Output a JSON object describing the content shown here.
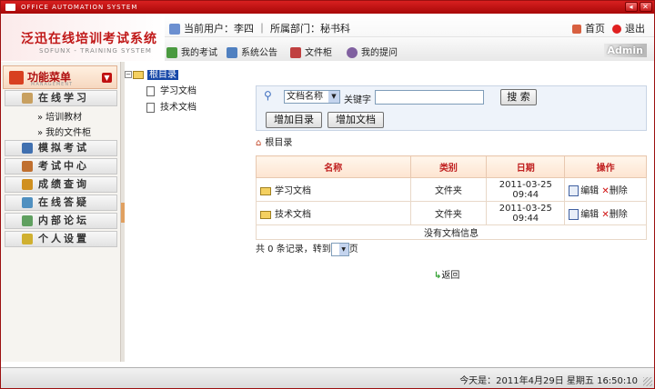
{
  "window": {
    "title": "OFFICE AUTOMATION SYSTEM"
  },
  "header": {
    "logo_title": "泛迅在线培训考试系统",
    "logo_sub": "SOFUNX - TRAINING SYSTEM",
    "user_info": "当前用户：李四 ｜ 所属部门：秘书科",
    "home": "首页",
    "logout": "退出",
    "nav": [
      "我的考试",
      "系统公告",
      "文件柜",
      "我的提问"
    ],
    "admin": "Admin"
  },
  "sidebar": {
    "title": "功能菜单",
    "subtitle": "MANAGEMENT",
    "items": [
      "在线学习",
      "模拟考试",
      "考试中心",
      "成绩查询",
      "在线答疑",
      "内部论坛",
      "个人设置"
    ],
    "subitems": [
      "培训教材",
      "我的文件柜"
    ]
  },
  "tree": {
    "root": "根目录",
    "children": [
      "学习文档",
      "技术文档"
    ]
  },
  "search": {
    "field": "文档名称",
    "keyword_label": "关键字",
    "keyword_value": "",
    "search_btn": "搜 索",
    "add_dir": "增加目录",
    "add_doc": "增加文档"
  },
  "breadcrumb": "根目录",
  "table": {
    "headers": [
      "名称",
      "类别",
      "日期",
      "操作"
    ],
    "rows": [
      {
        "name": "学习文档",
        "type": "文件夹",
        "date": "2011-03-25 09:44"
      },
      {
        "name": "技术文档",
        "type": "文件夹",
        "date": "2011-03-25 09:44"
      }
    ],
    "edit": "编辑",
    "delete": "删除",
    "empty": "没有文档信息"
  },
  "pager": {
    "prefix": "共 0 条记录，转到",
    "suffix": "页"
  },
  "back": "返回",
  "status": "今天是：2011年4月29日 星期五 16:50:10",
  "colors": {
    "accent": "#c01818",
    "title_bar": "#c81414"
  }
}
